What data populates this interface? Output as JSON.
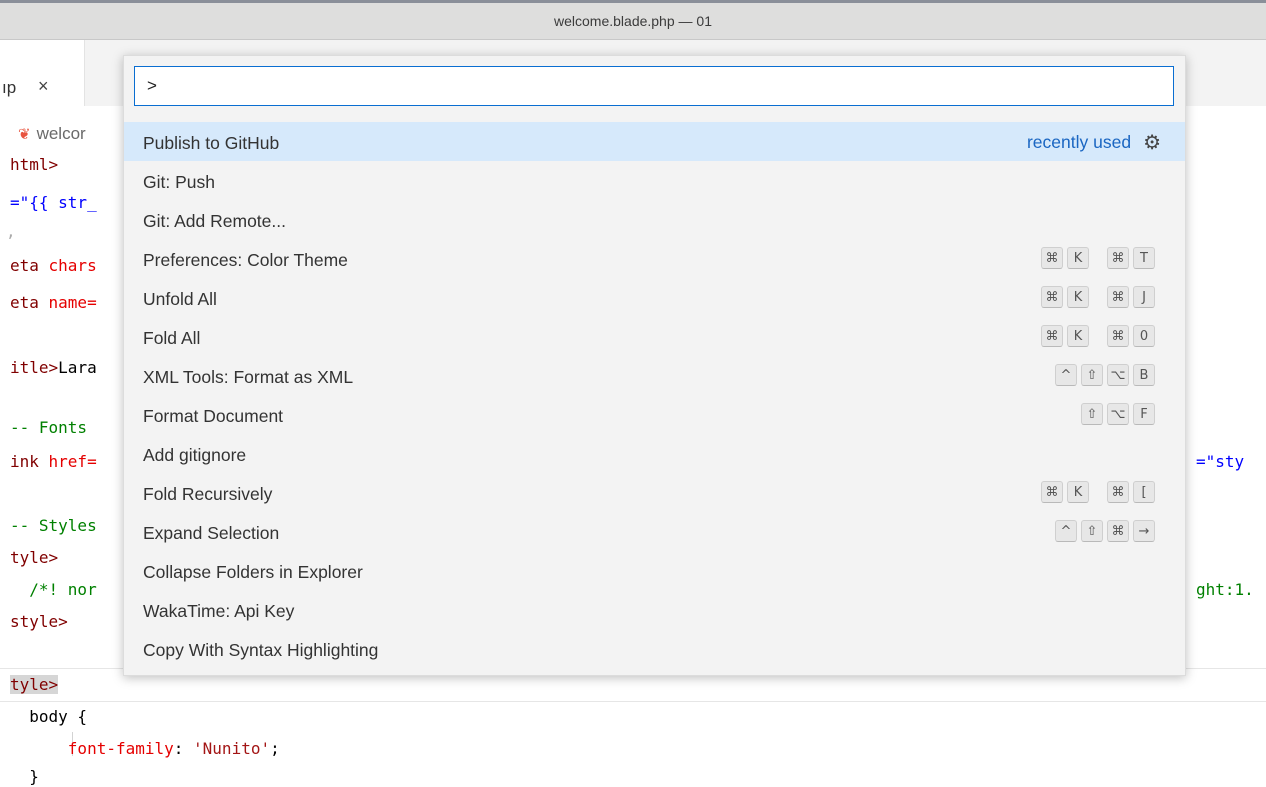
{
  "window": {
    "title": "welcome.blade.php — 01"
  },
  "tab": {
    "label": "ıp",
    "close": "×"
  },
  "breadcrumb": {
    "file": "welcor"
  },
  "code_lines": {
    "l1_tag": "html>",
    "l2": "=\"{{ str_",
    "l3": ",",
    "l4_a": "eta ",
    "l4_b": "chars",
    "l5_a": "eta ",
    "l5_b": "name=",
    "l6_a": "itle>",
    "l6_b": "Lara",
    "l7": "-- Fonts",
    "l8_a": "ink ",
    "l8_b": "href=",
    "l8_right": "=\"sty",
    "l9": "-- Styles",
    "l10": "tyle>",
    "l11": "  /*! nor",
    "l11_right": "ght:1.",
    "l12": "style>",
    "l13": "tyle>",
    "l14": "  body {",
    "l15_prop": "font-family",
    "l15_val": "'Nunito'",
    "l16": "  }"
  },
  "command_palette": {
    "input_value": ">",
    "recently_used": "recently used",
    "items": [
      {
        "label": "Publish to GitHub",
        "keys": []
      },
      {
        "label": "Git: Push",
        "keys": []
      },
      {
        "label": "Git: Add Remote...",
        "keys": []
      },
      {
        "label": "Preferences: Color Theme",
        "keys": [
          [
            "⌘",
            "K"
          ],
          [
            "⌘",
            "T"
          ]
        ]
      },
      {
        "label": "Unfold All",
        "keys": [
          [
            "⌘",
            "K"
          ],
          [
            "⌘",
            "J"
          ]
        ]
      },
      {
        "label": "Fold All",
        "keys": [
          [
            "⌘",
            "K"
          ],
          [
            "⌘",
            "0"
          ]
        ]
      },
      {
        "label": "XML Tools: Format as XML",
        "keys": [
          [
            "^",
            "⇧",
            "⌥",
            "B"
          ]
        ]
      },
      {
        "label": "Format Document",
        "keys": [
          [
            "⇧",
            "⌥",
            "F"
          ]
        ]
      },
      {
        "label": "Add gitignore",
        "keys": []
      },
      {
        "label": "Fold Recursively",
        "keys": [
          [
            "⌘",
            "K"
          ],
          [
            "⌘",
            "["
          ]
        ]
      },
      {
        "label": "Expand Selection",
        "keys": [
          [
            "^",
            "⇧",
            "⌘",
            "→"
          ]
        ]
      },
      {
        "label": "Collapse Folders in Explorer",
        "keys": []
      },
      {
        "label": "WakaTime: Api Key",
        "keys": []
      },
      {
        "label": "Copy With Syntax Highlighting",
        "keys": []
      }
    ]
  },
  "colors": {
    "accent": "#0a6ed1",
    "selected_row": "#d6e9fb"
  }
}
